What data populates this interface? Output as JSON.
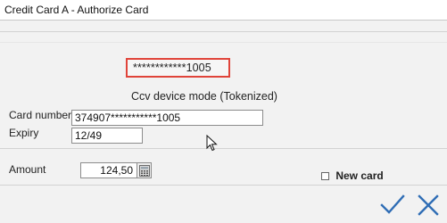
{
  "window": {
    "title": "Credit Card A - Authorize Card"
  },
  "card": {
    "masked_number_highlight": "************1005",
    "ccv_mode": "Ccv device mode (Tokenized)",
    "number_label": "Card number",
    "number_value": "374907***********1005",
    "expiry_label": "Expiry",
    "expiry_value": "12/49"
  },
  "amount": {
    "label": "Amount",
    "value": "124,50"
  },
  "new_card": {
    "label": "New card",
    "checked": false
  },
  "actions": {
    "confirm_icon": "checkmark-icon",
    "cancel_icon": "close-icon"
  },
  "colors": {
    "highlight_border": "#e0443a",
    "action_icons": "#2f6db5"
  }
}
